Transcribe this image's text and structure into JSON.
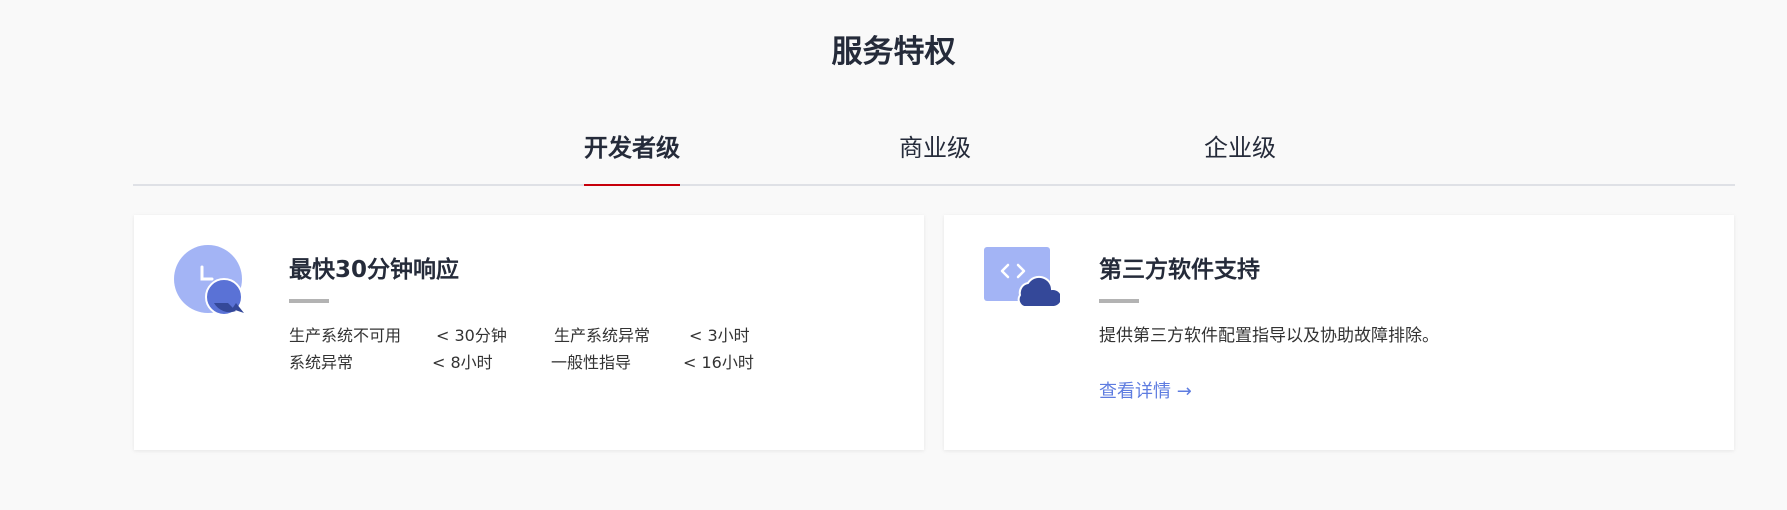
{
  "section": {
    "title": "服务特权"
  },
  "tabs": [
    {
      "label": "开发者级",
      "active": true
    },
    {
      "label": "商业级",
      "active": false
    },
    {
      "label": "企业级",
      "active": false
    }
  ],
  "cards": [
    {
      "icon": "clock-chat-icon",
      "title": "最快30分钟响应",
      "response_table": [
        [
          "生产系统不可用",
          "< 30分钟",
          "生产系统异常",
          "< 3小时"
        ],
        [
          "系统异常",
          "< 8小时",
          "一般性指导",
          "< 16小时"
        ]
      ]
    },
    {
      "icon": "code-cloud-icon",
      "title": "第三方软件支持",
      "description": "提供第三方软件配置指导以及协助故障排除。",
      "link": "查看详情 →"
    }
  ],
  "colors": {
    "accent_red": "#c7000b",
    "link_blue": "#5e7ce0",
    "icon_light_blue": "#a3b4f5",
    "icon_dark_blue": "#344899"
  }
}
